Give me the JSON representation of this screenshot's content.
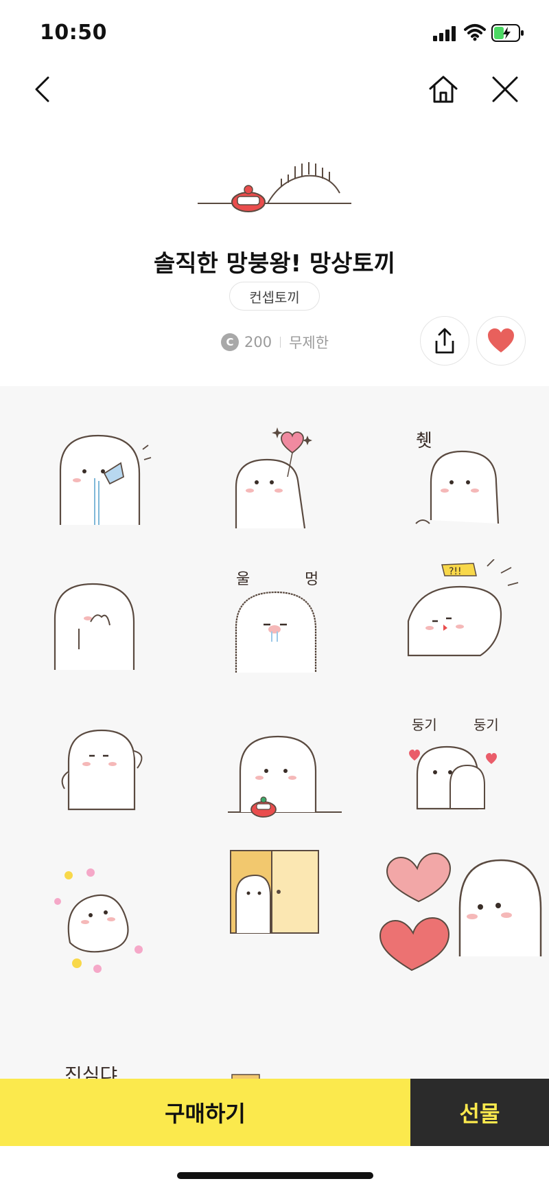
{
  "status_bar": {
    "time": "10:50"
  },
  "nav": {
    "back_icon": "chevron-left-icon",
    "home_icon": "home-icon",
    "close_icon": "close-icon"
  },
  "product": {
    "title": "솔직한 망붕왕! 망상토끼",
    "author": "컨셉토끼",
    "coin_symbol": "C",
    "price": "200",
    "period": "무제한"
  },
  "actions": {
    "share_icon": "share-icon",
    "like_icon": "heart-icon",
    "like_color": "#e8605c"
  },
  "sticker_grid": {
    "columns": 3,
    "stickers": [
      "rabbit-drinking-sticker",
      "rabbit-heart-balloon-sticker",
      "rabbit-shy-sticker",
      "rabbit-hiding-face-sticker",
      "rabbit-crying-sticker",
      "rabbit-surprised-sticker",
      "rabbit-flexing-sticker",
      "rabbit-with-clock-sticker",
      "rabbit-hugging-doll-sticker",
      "rabbit-flowers-sticker",
      "rabbit-door-peek-sticker",
      "rabbit-two-hearts-sticker"
    ],
    "texts": {
      "s3": "췟",
      "s5a": "울",
      "s5b": "멍",
      "s6": "?!!",
      "s9a": "둥기",
      "s9b": "둥기",
      "peek": "진심댜"
    }
  },
  "bottom_bar": {
    "buy_label": "구매하기",
    "gift_label": "선물",
    "buy_color": "#fbe94d",
    "gift_color": "#2b2b2b"
  }
}
